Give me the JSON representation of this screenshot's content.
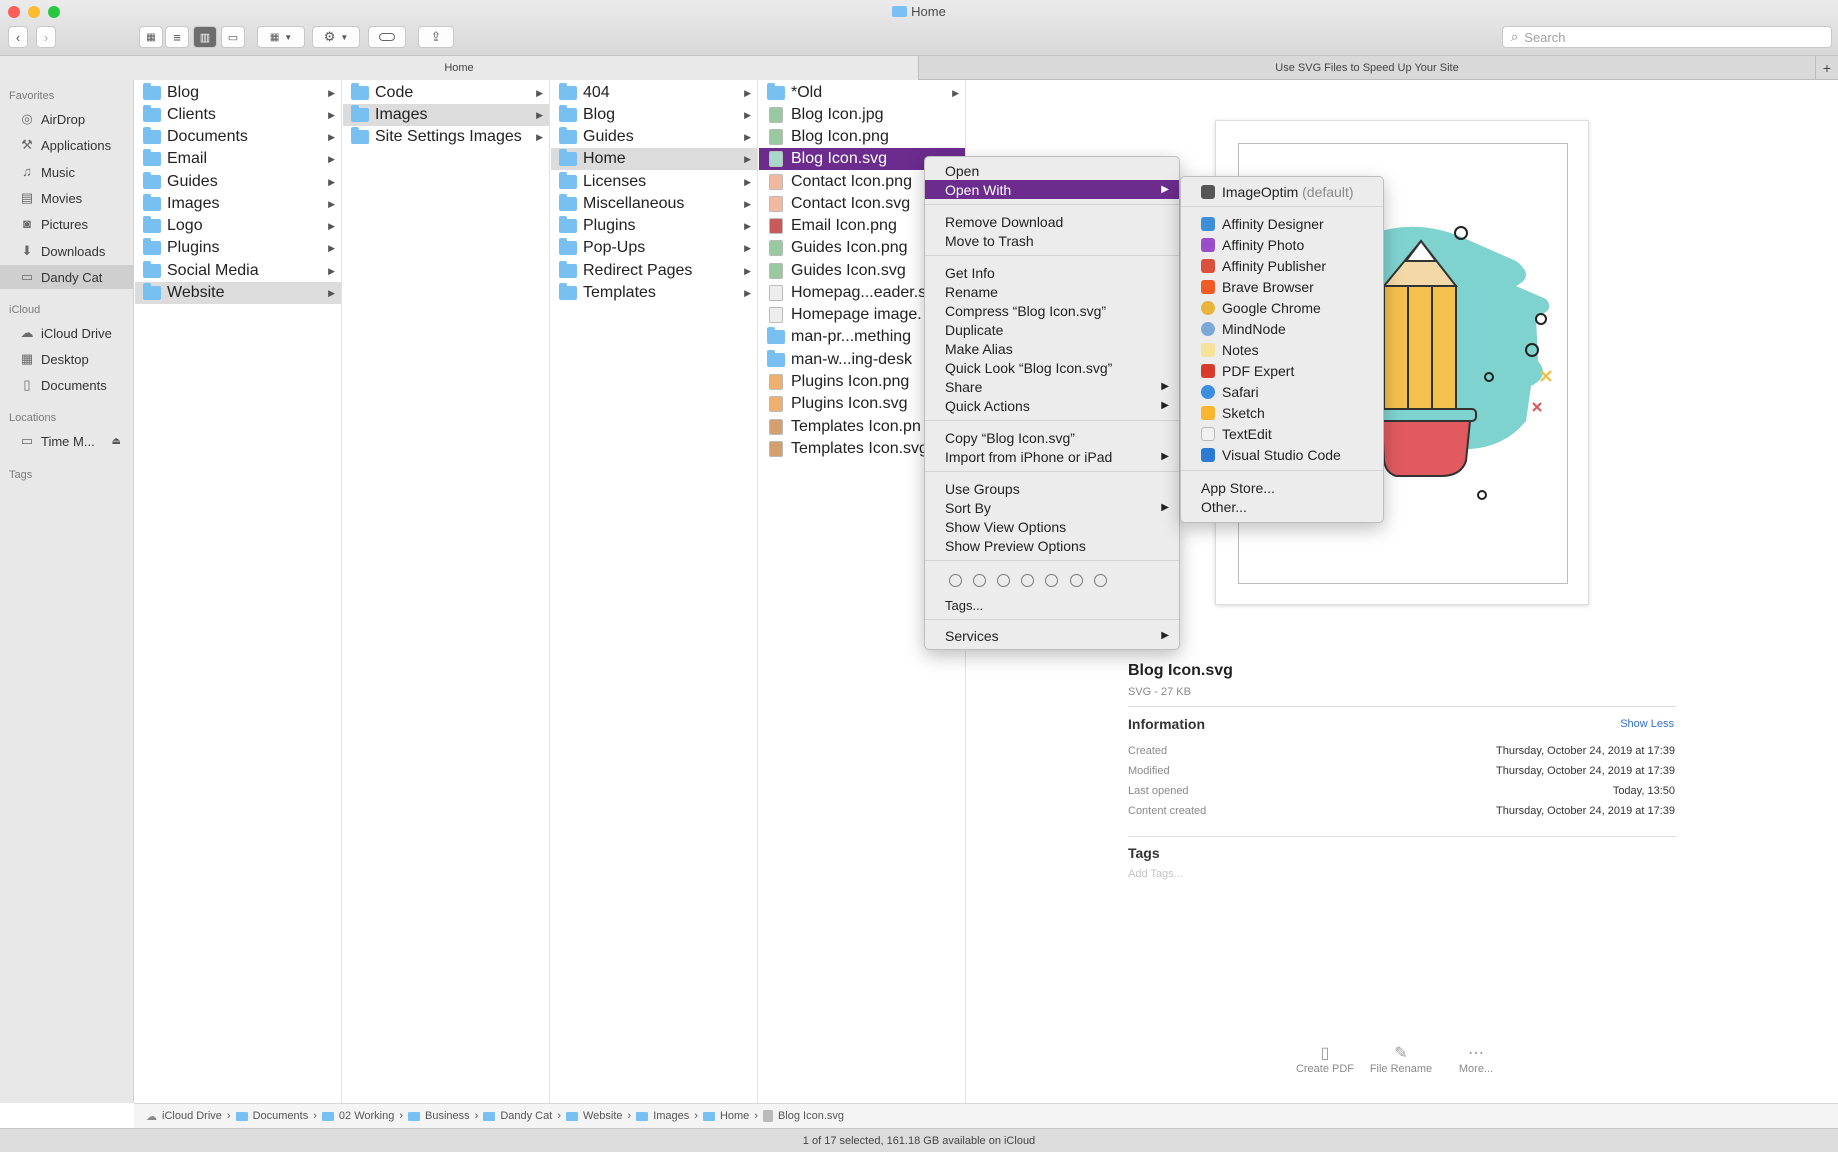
{
  "window": {
    "title": "Home",
    "search_placeholder": "Search"
  },
  "tabs": [
    {
      "label": "Home"
    },
    {
      "label": "Use SVG Files to Speed Up Your Site"
    }
  ],
  "sidebar": {
    "favorites_heading": "Favorites",
    "favorites": [
      "AirDrop",
      "Applications",
      "Music",
      "Movies",
      "Pictures",
      "Downloads",
      "Dandy Cat"
    ],
    "icloud_heading": "iCloud",
    "icloud": [
      "iCloud Drive",
      "Desktop",
      "Documents"
    ],
    "locations_heading": "Locations",
    "locations": [
      "Time M..."
    ],
    "tags_heading": "Tags"
  },
  "columns": {
    "col1": [
      "Blog",
      "Clients",
      "Documents",
      "Email",
      "Guides",
      "Images",
      "Logo",
      "Plugins",
      "Social Media",
      "Website"
    ],
    "col2": [
      "Code",
      "Images",
      "Site Settings Images"
    ],
    "col3": [
      "404",
      "Blog",
      "Guides",
      "Home",
      "Licenses",
      "Miscellaneous",
      "Plugins",
      "Pop-Ups",
      "Redirect Pages",
      "Templates"
    ],
    "col4": [
      "*Old",
      "Blog Icon.jpg",
      "Blog Icon.png",
      "Blog Icon.svg",
      "Contact Icon.png",
      "Contact Icon.svg",
      "Email Icon.png",
      "Guides Icon.png",
      "Guides Icon.svg",
      "Homepag...eader.s",
      "Homepage image.",
      "man-pr...mething",
      "man-w...ing-desk",
      "Plugins Icon.png",
      "Plugins Icon.svg",
      "Templates Icon.pn",
      "Templates Icon.svg"
    ]
  },
  "context_menu": {
    "group1": [
      "Open",
      "Open With"
    ],
    "group2": [
      "Remove Download",
      "Move to Trash"
    ],
    "group3": [
      "Get Info",
      "Rename",
      "Compress “Blog Icon.svg”",
      "Duplicate",
      "Make Alias",
      "Quick Look “Blog Icon.svg”",
      "Share",
      "Quick Actions"
    ],
    "group4": [
      "Copy “Blog Icon.svg”",
      "Import from iPhone or iPad"
    ],
    "group5": [
      "Use Groups",
      "Sort By",
      "Show View Options",
      "Show Preview Options"
    ],
    "tags_label": "Tags...",
    "services": "Services"
  },
  "open_with_menu": {
    "default_app": "ImageOptim",
    "default_suffix": "(default)",
    "apps": [
      "Affinity Designer",
      "Affinity Photo",
      "Affinity Publisher",
      "Brave Browser",
      "Google Chrome",
      "MindNode",
      "Notes",
      "PDF Expert",
      "Safari",
      "Sketch",
      "TextEdit",
      "Visual Studio Code"
    ],
    "app_store": "App Store...",
    "other": "Other..."
  },
  "preview": {
    "filename": "Blog Icon.svg",
    "meta": "SVG - 27 KB",
    "info_heading": "Information",
    "show_less": "Show Less",
    "created_label": "Created",
    "created_value": "Thursday, October 24, 2019 at 17:39",
    "modified_label": "Modified",
    "modified_value": "Thursday, October 24, 2019 at 17:39",
    "opened_label": "Last opened",
    "opened_value": "Today, 13:50",
    "content_label": "Content created",
    "content_value": "Thursday, October 24, 2019 at 17:39",
    "tags_heading": "Tags",
    "add_tags": "Add Tags...",
    "actions": [
      "Create PDF",
      "File Rename",
      "More..."
    ]
  },
  "pathbar": [
    "iCloud Drive",
    "Documents",
    "02 Working",
    "Business",
    "Dandy Cat",
    "Website",
    "Images",
    "Home",
    "Blog Icon.svg"
  ],
  "status": "1 of 17 selected, 161.18 GB available on iCloud",
  "colors": {
    "selection": "#6b2c8e",
    "folder": "#78bff2"
  }
}
